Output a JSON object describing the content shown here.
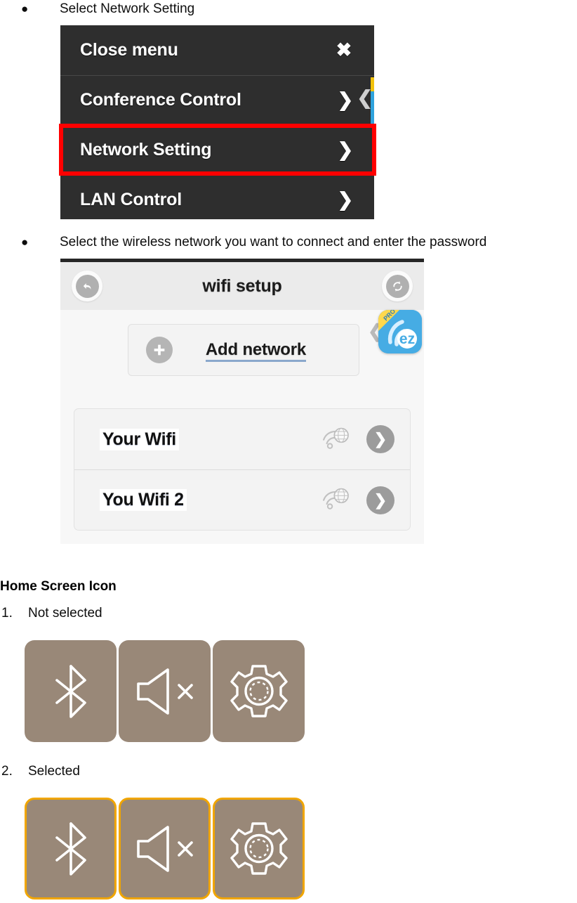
{
  "steps": {
    "step1_bullet": "●",
    "step1_text": "Select Network Setting",
    "step2_bullet": "●",
    "step2_text": "Select the wireless network you want to connect and enter the password"
  },
  "device_menu": {
    "items": [
      {
        "label": "Close menu",
        "icon": "close-icon",
        "glyph": "✖",
        "highlighted": false
      },
      {
        "label": "Conference Control",
        "icon": "chevron-right-icon",
        "glyph": "❯",
        "highlighted": false
      },
      {
        "label": "Network Setting",
        "icon": "chevron-right-icon",
        "glyph": "❯",
        "highlighted": true
      },
      {
        "label": "LAN Control",
        "icon": "chevron-right-icon",
        "glyph": "❯",
        "highlighted": false
      }
    ],
    "panel_color": "#2e2e2e",
    "highlight_color": "#ff0000",
    "behind_chevron_glyph": "❮",
    "sliver_yellow": "#f2c20c",
    "sliver_blue": "#2fa3dd"
  },
  "wifi_setup": {
    "title": "wifi setup",
    "back_icon": "back-arrow-icon",
    "back_glyph": "↺",
    "refresh_icon": "refresh-icon",
    "refresh_glyph": "⟳",
    "add_network_label": "Add network",
    "add_network_icon": "plus-icon",
    "add_network_glyph": "＋",
    "underline_color": "#8aa8cc",
    "networks": [
      {
        "name": "Your Wifi",
        "signal_icon": "wifi-signal-globe-icon",
        "go_icon": "chevron-right-icon",
        "go_glyph": "❯"
      },
      {
        "name": "You Wifi 2",
        "signal_icon": "wifi-signal-globe-icon",
        "go_icon": "chevron-right-icon",
        "go_glyph": "❯"
      }
    ],
    "app_icon": {
      "name": "ezcast-pro-app-icon",
      "badge": "PRO",
      "wordmark": "ez",
      "bg_color": "#46ace4",
      "badge_color": "#ffd84d"
    }
  },
  "home_screen_icon": {
    "heading": "Home Screen Icon",
    "groups": [
      {
        "number": "1.",
        "label": "Not selected",
        "selected": false,
        "tiles": [
          {
            "icon": "bluetooth-icon",
            "name": "bluetooth"
          },
          {
            "icon": "speaker-mute-icon",
            "name": "mute"
          },
          {
            "icon": "gear-icon",
            "name": "settings"
          }
        ]
      },
      {
        "number": "2.",
        "label": "Selected",
        "selected": true,
        "tiles": [
          {
            "icon": "bluetooth-icon",
            "name": "bluetooth"
          },
          {
            "icon": "speaker-mute-icon",
            "name": "mute"
          },
          {
            "icon": "gear-icon",
            "name": "settings"
          }
        ]
      }
    ],
    "tile_color": "#998878",
    "selected_border_color": "#f0a500"
  }
}
